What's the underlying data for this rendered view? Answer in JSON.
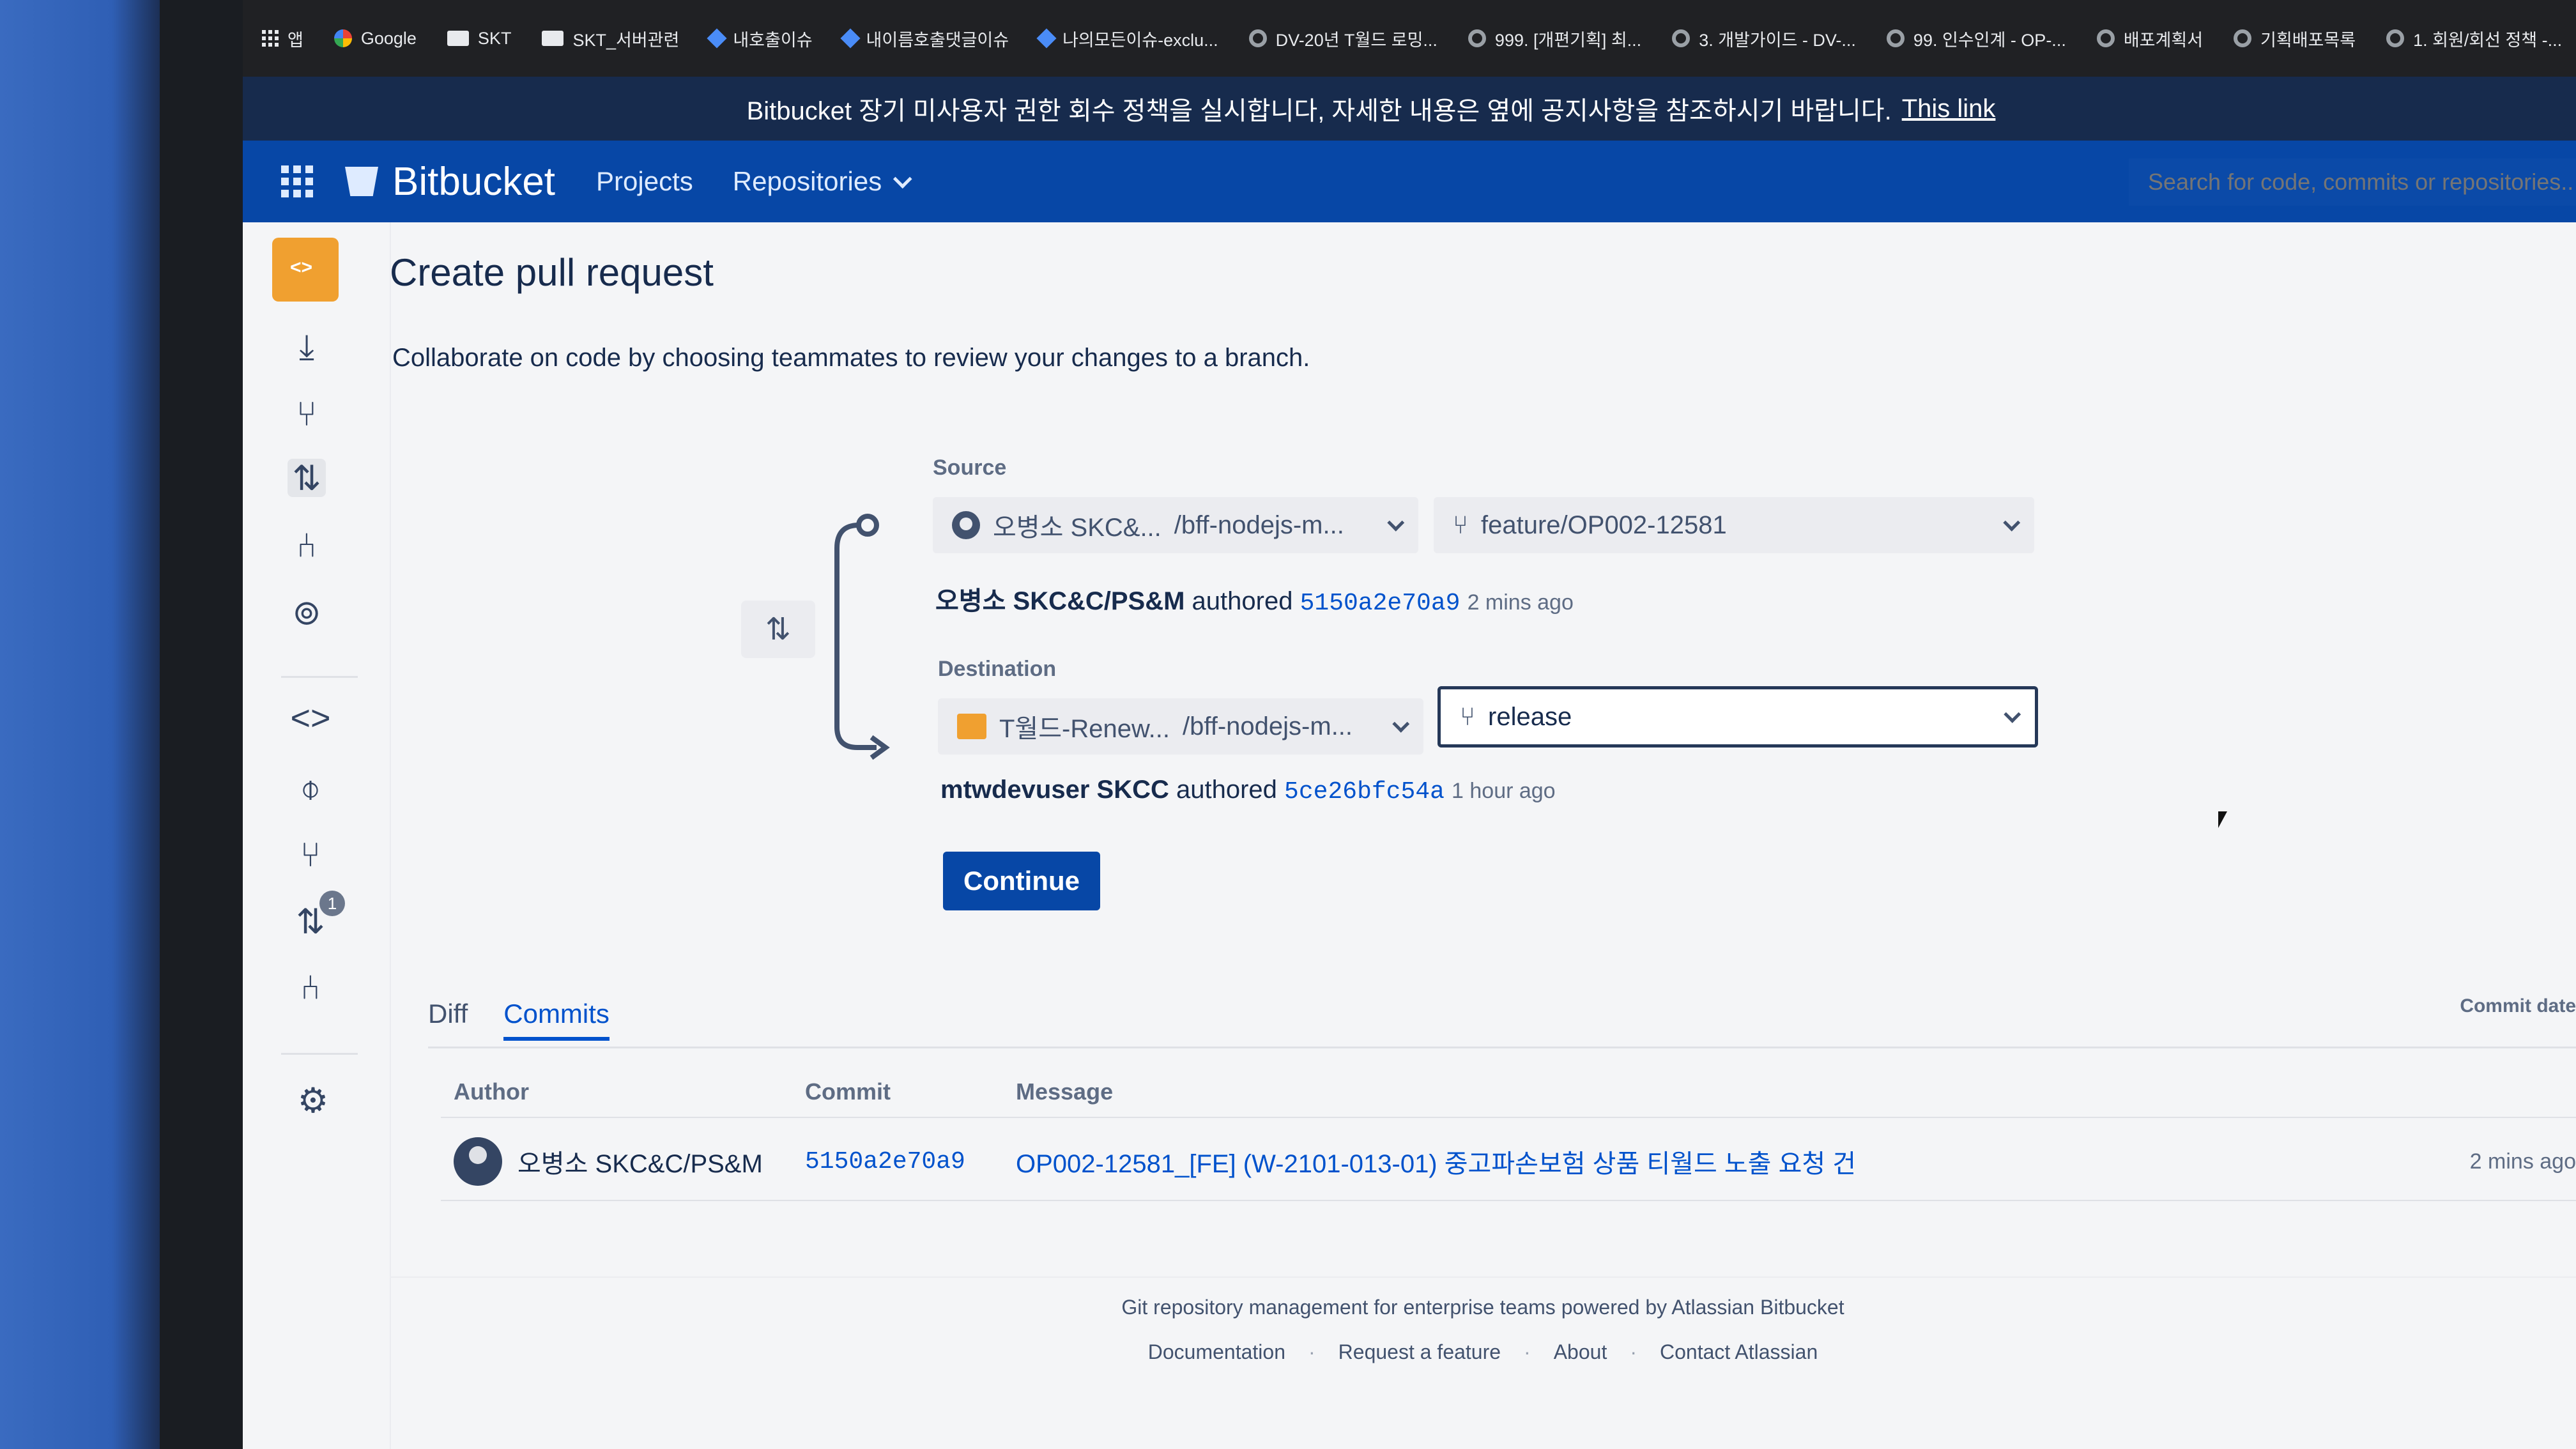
{
  "browser": {
    "url_fragment": "...pull-requests?create&targetBranch=refs%2Fheads%2Frelease&sourceBranch=refs%2Fheads%2Ffeature%2FOP00...",
    "bookmarks": [
      {
        "label": "앱",
        "icon": "apps-icon"
      },
      {
        "label": "Google",
        "icon": "google-icon"
      },
      {
        "label": "SKT",
        "icon": "folder-icon"
      },
      {
        "label": "SKT_서버관련",
        "icon": "folder-icon"
      },
      {
        "label": "내호출이슈",
        "icon": "jira-icon"
      },
      {
        "label": "내이름호출댓글이슈",
        "icon": "jira-icon"
      },
      {
        "label": "나의모든이슈-exclu...",
        "icon": "jira-icon"
      },
      {
        "label": "DV-20년 T월드 로밍...",
        "icon": "confluence-icon"
      },
      {
        "label": "999. [개편기획] 최...",
        "icon": "confluence-icon"
      },
      {
        "label": "3. 개발가이드 - DV-...",
        "icon": "confluence-icon"
      },
      {
        "label": "99. 인수인계 - OP-...",
        "icon": "confluence-icon"
      },
      {
        "label": "배포계획서",
        "icon": "confluence-icon"
      },
      {
        "label": "기획배포목록",
        "icon": "confluence-icon"
      },
      {
        "label": "1. 회원/회선 정책 -...",
        "icon": "confluence-icon"
      }
    ]
  },
  "banner": {
    "text": "Bitbucket 장기 미사용자 권한 회수 정책을 실시합니다, 자세한 내용은 옆에 공지사항을 참조하시기 바랍니다.",
    "link": "This link"
  },
  "header": {
    "brand": "Bitbucket",
    "nav": {
      "projects": "Projects",
      "repositories": "Repositories"
    },
    "search_placeholder": "Search for code, commits or repositories..."
  },
  "sidebar": {
    "pr_badge": "1"
  },
  "page": {
    "title": "Create pull request",
    "description": "Collaborate on code by choosing teammates to review your changes to a branch.",
    "source": {
      "label": "Source",
      "repo": "오병소 SKC&...",
      "repo_path": "/bff-nodejs-m...",
      "branch": "feature/OP002-12581",
      "author": "오병소 SKC&C/PS&M",
      "authored_word": "authored",
      "commit": "5150a2e70a9",
      "time": "2 mins ago"
    },
    "destination": {
      "label": "Destination",
      "repo": "T월드-Renew...",
      "repo_path": "/bff-nodejs-m...",
      "branch": "release",
      "author": "mtwdevuser SKCC",
      "authored_word": "authored",
      "commit": "5ce26bfc54a",
      "time": "1 hour ago"
    },
    "continue_label": "Continue",
    "tabs": {
      "diff": "Diff",
      "commits": "Commits"
    },
    "table": {
      "headers": {
        "author": "Author",
        "commit": "Commit",
        "message": "Message",
        "commit_date": "Commit date"
      },
      "rows": [
        {
          "author": "오병소 SKC&C/PS&M",
          "commit": "5150a2e70a9",
          "message": "OP002-12581_[FE] (W-2101-013-01) 중고파손보험 상품 티월드 노출 요청 건",
          "date": "2 mins ago"
        }
      ]
    }
  },
  "footer": {
    "text": "Git repository management for enterprise teams powered by Atlassian Bitbucket",
    "links": [
      "Documentation",
      "Request a feature",
      "About",
      "Contact Atlassian"
    ]
  },
  "colors": {
    "nav_bg": "#0747a6",
    "banner_bg": "#172b4d",
    "link": "#0052cc",
    "repo_avatar": "#f0a030"
  }
}
